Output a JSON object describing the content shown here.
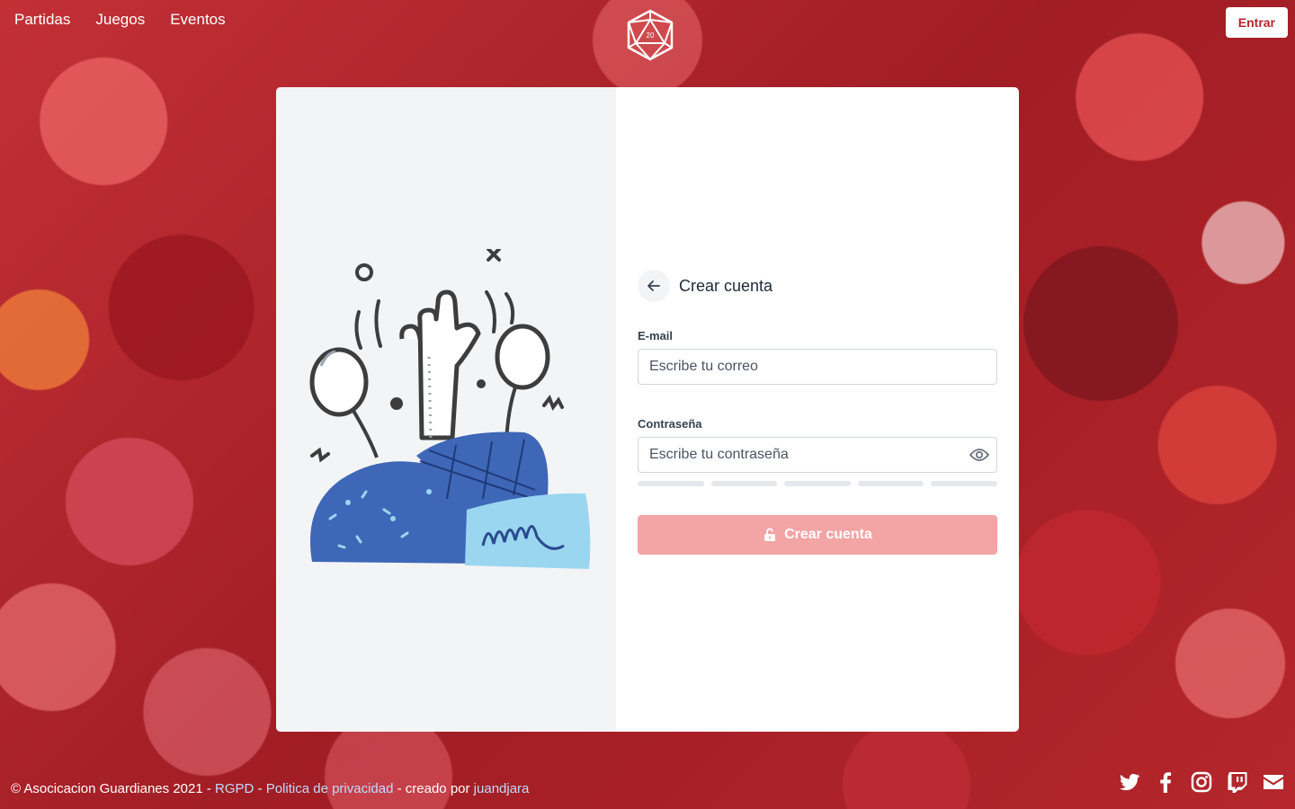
{
  "nav": {
    "links": [
      "Partidas",
      "Juegos",
      "Eventos"
    ],
    "logo_icon": "d20-dice-icon",
    "logo_text": "20",
    "login_label": "Entrar"
  },
  "form": {
    "title": "Crear cuenta",
    "email_label": "E-mail",
    "email_placeholder": "Escribe tu correo",
    "email_value": "",
    "password_label": "Contraseña",
    "password_placeholder": "Escribe tu contraseña",
    "password_value": "",
    "password_strength_segments": 5,
    "password_strength_filled": 0,
    "submit_label": "Crear cuenta",
    "submit_icon": "unlock-icon"
  },
  "footer": {
    "copyright": "© Asocicacion Guardianes 2021 - ",
    "rgpd": "RGPD",
    "sep1": " - ",
    "privacy": "Politica de privacidad",
    "created_by": " - creado por ",
    "author": "juandjara",
    "social_icons": [
      "twitter-icon",
      "facebook-icon",
      "instagram-icon",
      "twitch-icon",
      "email-icon"
    ]
  },
  "colors": {
    "brand": "#b4262b",
    "submit_disabled": "#f3a4a4",
    "link": "#bfdbfe",
    "illustration_blue": "#3f67b7",
    "illustration_light_blue": "#9ad6f0"
  }
}
